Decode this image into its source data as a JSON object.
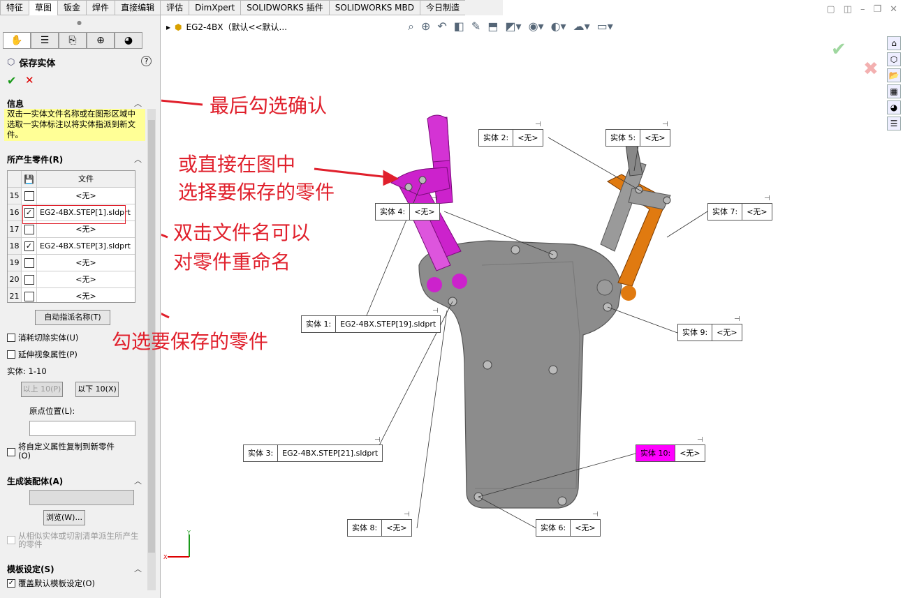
{
  "tabs": [
    "特征",
    "草图",
    "钣金",
    "焊件",
    "直接编辑",
    "评估",
    "DimXpert",
    "SOLIDWORKS 插件",
    "SOLIDWORKS MBD",
    "今日制造"
  ],
  "active_tab": 1,
  "document_title": "EG2-4BX（默认<<默认...",
  "panel": {
    "title": "保存实体",
    "help": "?",
    "ok": "✔",
    "cancel": "✕",
    "info_header": "信息",
    "info_text": "双击一实体文件名称或在图形区域中选取一实体标注以将实体指派到新文件。",
    "parts_header": "所产生零件(R)",
    "grid_header": "文件",
    "rows": [
      {
        "num": "15",
        "checked": false,
        "file": "<无>"
      },
      {
        "num": "16",
        "checked": true,
        "file": "EG2-4BX.STEP[1].sldprt"
      },
      {
        "num": "17",
        "checked": false,
        "file": "<无>"
      },
      {
        "num": "18",
        "checked": true,
        "file": "EG2-4BX.STEP[3].sldprt"
      },
      {
        "num": "19",
        "checked": false,
        "file": "<无>"
      },
      {
        "num": "20",
        "checked": false,
        "file": "<无>"
      },
      {
        "num": "21",
        "checked": false,
        "file": "<无>"
      }
    ],
    "auto_assign": "自动指派名称(T)",
    "consume_cut": "消耗切除实体(U)",
    "extend_view": "延伸视象属性(P)",
    "body_range": "实体: 1-10",
    "prev10": "以上 10(P)",
    "next10": "以下 10(X)",
    "origin_label": "原点位置(L):",
    "copy_props": "将自定义属性复制到新零件(O)",
    "assembly_header": "生成装配体(A)",
    "browse": "浏览(W)...",
    "derive_label": "从相似实体或切割清单派生所产生的零件",
    "template_header": "模板设定(S)",
    "override_template": "覆盖默认模板设定(O)"
  },
  "callouts": [
    {
      "id": "c2",
      "label": "实体  2:",
      "value": "<无>"
    },
    {
      "id": "c5",
      "label": "实体  5:",
      "value": "<无>"
    },
    {
      "id": "c4",
      "label": "实体  4:",
      "value": "<无>"
    },
    {
      "id": "c7",
      "label": "实体  7:",
      "value": "<无>"
    },
    {
      "id": "c1",
      "label": "实体  1:",
      "value": "EG2-4BX.STEP[19].sldprt"
    },
    {
      "id": "c9",
      "label": "实体  9:",
      "value": "<无>"
    },
    {
      "id": "c3",
      "label": "实体  3:",
      "value": "EG2-4BX.STEP[21].sldprt"
    },
    {
      "id": "c10",
      "label": "实体 10:",
      "value": "<无>"
    },
    {
      "id": "c8",
      "label": "实体  8:",
      "value": "<无>"
    },
    {
      "id": "c6",
      "label": "实体  6:",
      "value": "<无>"
    }
  ],
  "annotations": {
    "confirm": "最后勾选确认",
    "select_in_view": "或直接在图中",
    "select_in_view_2": "选择要保存的零件",
    "rename_1": "双击文件名可以",
    "rename_2": "对零件重命名",
    "check_parts": "勾选要保存的零件"
  },
  "axes": {
    "x": "X",
    "y": "Y"
  },
  "colors": {
    "accent_annotation": "#e0202c",
    "part_magenta": "#cc22cc",
    "part_orange": "#e07a10",
    "body_gray": "#8c8c8c"
  }
}
